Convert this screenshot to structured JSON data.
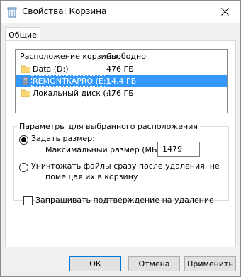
{
  "window": {
    "title": "Свойства: Корзина"
  },
  "tabs": [
    {
      "label": "Общие"
    }
  ],
  "listview": {
    "columns": [
      "Расположение корзины",
      "Свободно"
    ],
    "rows": [
      {
        "name": "Data (D:)",
        "free": "476 ГБ",
        "icon": "folder-icon"
      },
      {
        "name": "REMONTKAPRO (E:)",
        "free": "14,4 ГБ",
        "icon": "drive-icon",
        "selected": true
      },
      {
        "name": "Локальный диск (...",
        "free": "476 ГБ",
        "icon": "folder-icon"
      }
    ]
  },
  "settings": {
    "group_title": "Параметры для выбранного расположения",
    "custom_size_label": "Задать размер:",
    "max_size_label": "Максимальный размер (МБ):",
    "max_size_value": "1479",
    "delete_immediately_label_1": "Уничтожать файлы сразу после удаления, не",
    "delete_immediately_label_2": "помещая их в корзину",
    "confirm_label": "Запрашивать подтверждение на удаление",
    "custom_size_selected": true,
    "confirm_checked": false
  },
  "buttons": {
    "ok": "ОК",
    "cancel": "Отмена",
    "apply": "Применить"
  },
  "colors": {
    "selection": "#3399ff",
    "accent": "#0078d7",
    "folder": "#f8d775"
  }
}
